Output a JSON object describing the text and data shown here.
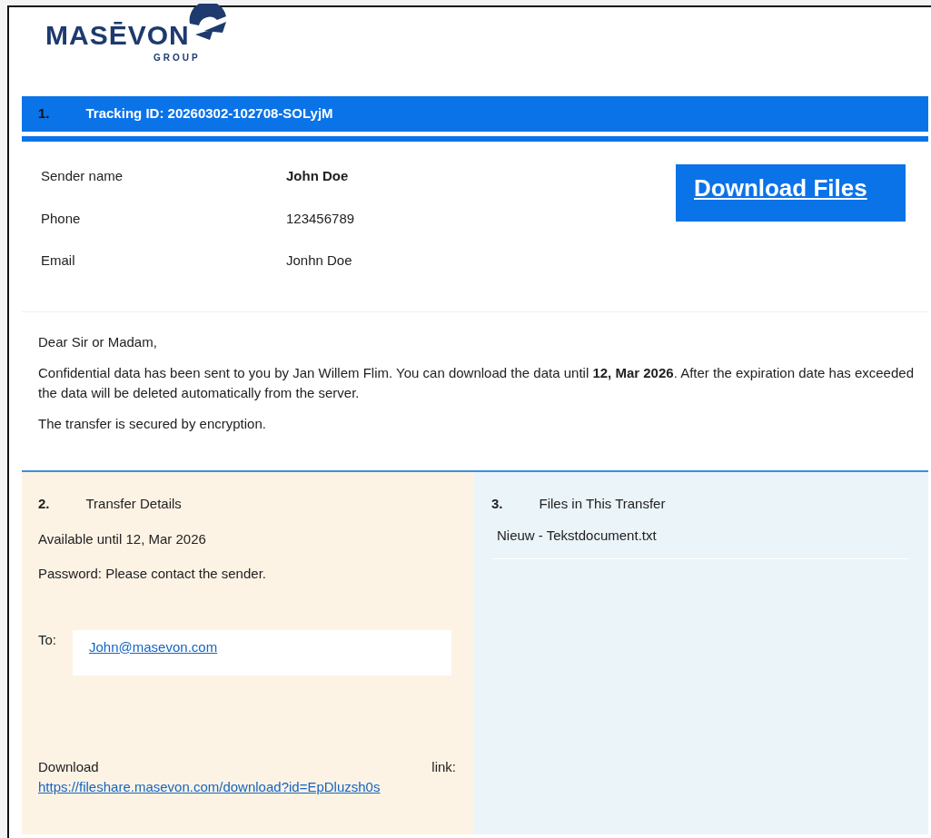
{
  "logo": {
    "wordmark": "MASĒVON",
    "subtitle": "GROUP"
  },
  "header": {
    "number": "1.",
    "title": "Tracking ID: 20260302-102708-SOLyjM"
  },
  "sender": [
    {
      "label": "Sender name",
      "value": "John Doe",
      "bold": true
    },
    {
      "label": "Phone",
      "value": "123456789",
      "bold": false
    },
    {
      "label": "Email",
      "value": "Jonhn Doe",
      "bold": false
    }
  ],
  "download_button": "Download Files",
  "message": [
    "Dear Sir or Madam,",
    "Confidential data has been sent to you by Jan Willem Flim. You can download the data until **12, Mar 2026**. After the expiration date has exceeded the data will be deleted automatically from the server.",
    "The transfer is secured by encryption."
  ],
  "transfer_details": {
    "number": "2.",
    "title": "Transfer Details",
    "available": "Available until 12, Mar 2026",
    "password": "Password: Please contact the sender.",
    "to_label": "To:",
    "to_email": "John@masevon.com",
    "download_label": "Download link:",
    "download_url": "https://fileshare.masevon.com/download?id=EpDluzsh0s"
  },
  "files": {
    "number": "3.",
    "title": "Files in This Transfer",
    "items": [
      "Nieuw - Tekstdocument.txt"
    ]
  }
}
